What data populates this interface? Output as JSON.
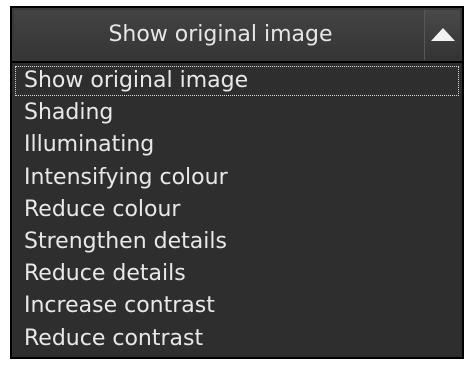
{
  "combo": {
    "selected_label": "Show original image",
    "toggle_icon": "chevron-up-icon",
    "options": [
      "Show original image",
      "Shading",
      "Illuminating",
      "Intensifying colour",
      "Reduce colour",
      "Strengthen details",
      "Reduce details",
      "Increase contrast",
      "Reduce contrast"
    ],
    "focused_index": 0
  },
  "colors": {
    "header_bg": "#383838",
    "list_bg": "#2e2e2e",
    "text": "#e8e8e8",
    "border": "#000000"
  }
}
